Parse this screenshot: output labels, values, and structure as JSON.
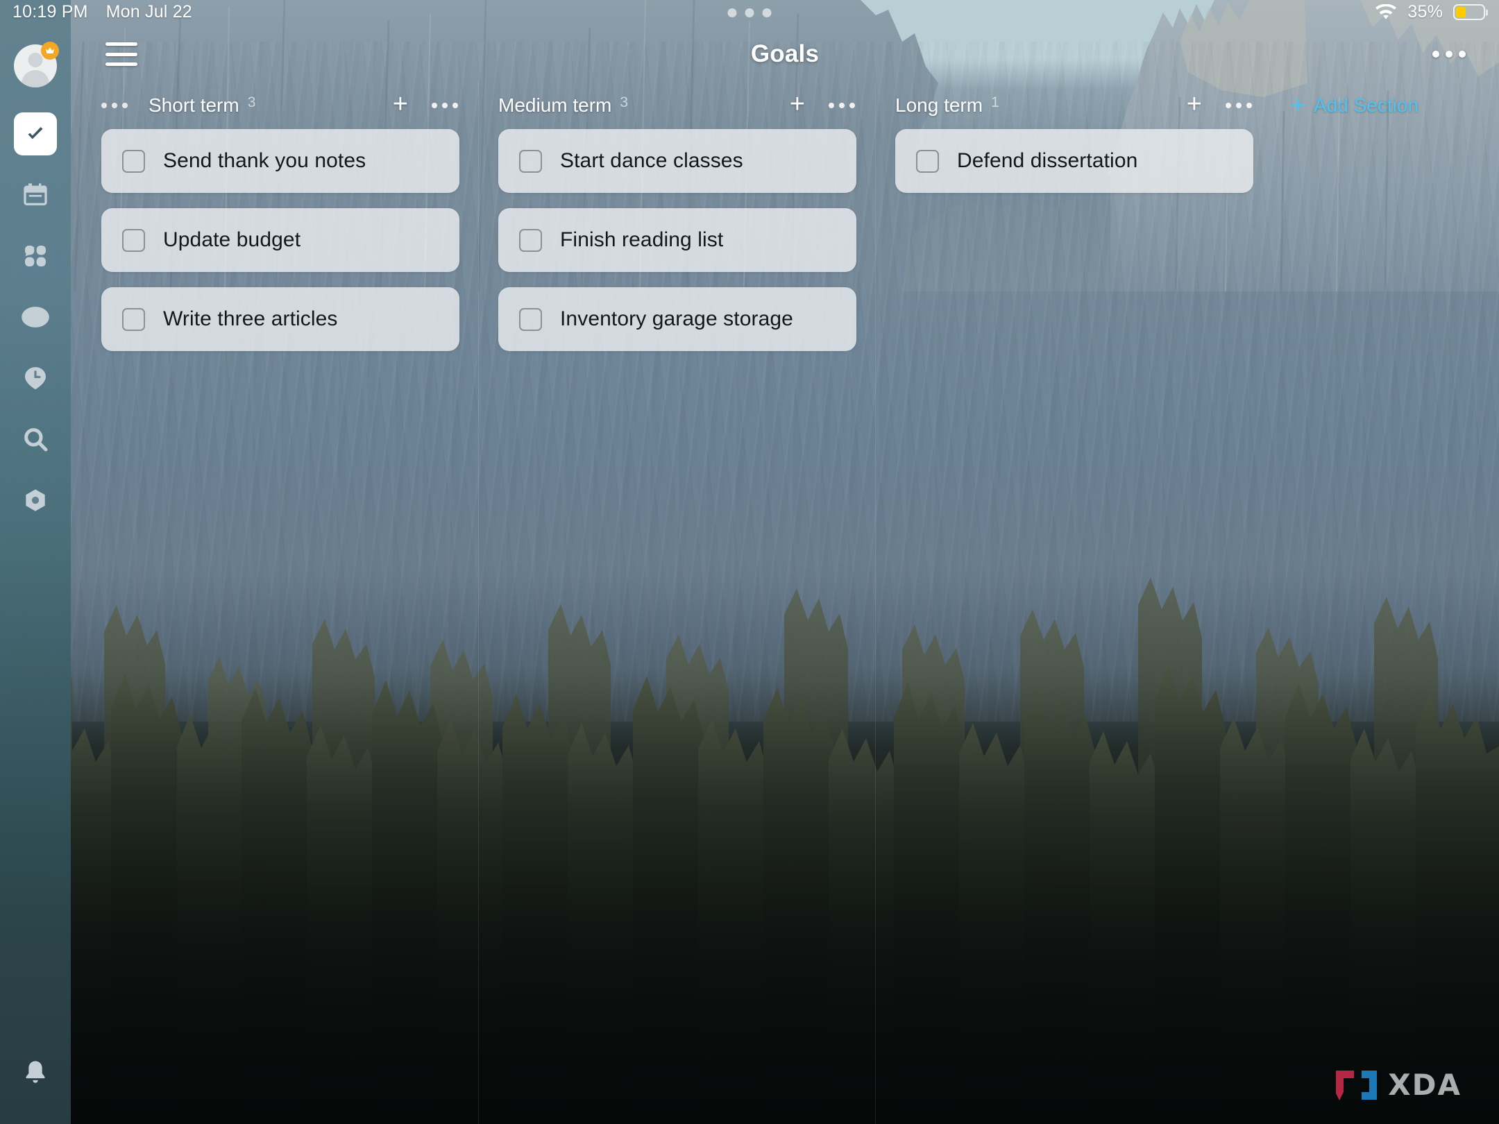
{
  "status_bar": {
    "time": "10:19 PM",
    "date": "Mon Jul 22",
    "battery_percent": "35%",
    "wifi_icon": "wifi-icon",
    "battery_icon": "battery-low-power-icon"
  },
  "sidebar": {
    "avatar": {
      "name": "user-avatar",
      "badge_icon": "crown-badge-icon"
    },
    "items": [
      {
        "icon": "check-circle-icon",
        "name": "tasks",
        "active": true
      },
      {
        "icon": "calendar-icon",
        "name": "calendar",
        "active": false
      },
      {
        "icon": "grid-habit-icon",
        "name": "habits",
        "active": false
      },
      {
        "icon": "target-eye-icon",
        "name": "focus",
        "active": false
      },
      {
        "icon": "pomodoro-clock-icon",
        "name": "pomodoro",
        "active": false
      },
      {
        "icon": "search-icon",
        "name": "search",
        "active": false
      },
      {
        "icon": "settings-gear-icon",
        "name": "settings",
        "active": false
      }
    ],
    "bottom_item": {
      "icon": "bell-icon",
      "name": "notifications"
    }
  },
  "header": {
    "menu_icon": "hamburger-menu-icon",
    "title": "Goals",
    "more_icon": "more-options-icon"
  },
  "board": {
    "columns": [
      {
        "title": "Short term",
        "count": "3",
        "add_icon": "plus-icon",
        "menu_icon": "more-options-icon",
        "tasks": [
          {
            "label": "Send thank you notes",
            "checked": false
          },
          {
            "label": "Update budget",
            "checked": false
          },
          {
            "label": "Write three articles",
            "checked": false
          }
        ]
      },
      {
        "title": "Medium term",
        "count": "3",
        "add_icon": "plus-icon",
        "menu_icon": "more-options-icon",
        "tasks": [
          {
            "label": "Start dance classes",
            "checked": false
          },
          {
            "label": "Finish reading list",
            "checked": false
          },
          {
            "label": "Inventory garage storage",
            "checked": false
          }
        ]
      },
      {
        "title": "Long term",
        "count": "1",
        "add_icon": "plus-icon",
        "menu_icon": "more-options-icon",
        "tasks": [
          {
            "label": "Defend dissertation",
            "checked": false
          }
        ]
      }
    ],
    "add_section": {
      "label": "Add Section",
      "icon": "plus-icon",
      "color": "#4ec3f0"
    }
  },
  "watermark": {
    "text": "XDA",
    "left_bracket_color": "#c0294a",
    "right_bracket_color": "#1f7fc0",
    "text_color": "#b3b7ba"
  },
  "colors": {
    "accent": "#4ec3f0",
    "battery_low_power": "#ffcc00",
    "crown_badge": "#f5a623",
    "card_background": "rgba(236,239,241,0.80)",
    "sidebar_top": "#61818f",
    "sidebar_bottom": "#283d42"
  }
}
